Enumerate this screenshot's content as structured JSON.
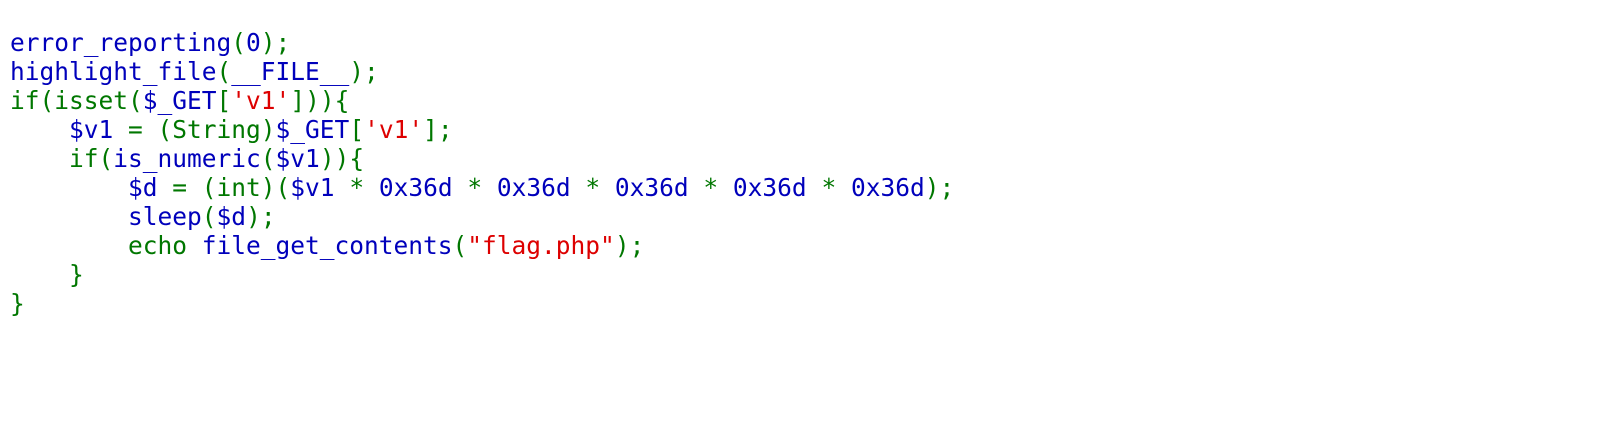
{
  "colors": {
    "default": "#0000BB",
    "keyword": "#007700",
    "string": "#DD0000",
    "background": "#FFFFFF"
  },
  "code": {
    "lines": [
      [
        {
          "t": "error_reporting",
          "c": "default"
        },
        {
          "t": "(",
          "c": "keyword"
        },
        {
          "t": "0",
          "c": "default"
        },
        {
          "t": ");",
          "c": "keyword"
        }
      ],
      [
        {
          "t": "highlight_file",
          "c": "default"
        },
        {
          "t": "(",
          "c": "keyword"
        },
        {
          "t": "__FILE__",
          "c": "default"
        },
        {
          "t": ");",
          "c": "keyword"
        }
      ],
      [
        {
          "t": "if(isset(",
          "c": "keyword"
        },
        {
          "t": "$_GET",
          "c": "default"
        },
        {
          "t": "[",
          "c": "keyword"
        },
        {
          "t": "'v1'",
          "c": "string"
        },
        {
          "t": "])){",
          "c": "keyword"
        }
      ],
      [
        {
          "t": "    ",
          "c": "keyword"
        },
        {
          "t": "$v1 ",
          "c": "default"
        },
        {
          "t": "= (String)",
          "c": "keyword"
        },
        {
          "t": "$_GET",
          "c": "default"
        },
        {
          "t": "[",
          "c": "keyword"
        },
        {
          "t": "'v1'",
          "c": "string"
        },
        {
          "t": "];",
          "c": "keyword"
        }
      ],
      [
        {
          "t": "    if(",
          "c": "keyword"
        },
        {
          "t": "is_numeric",
          "c": "default"
        },
        {
          "t": "(",
          "c": "keyword"
        },
        {
          "t": "$v1",
          "c": "default"
        },
        {
          "t": ")){",
          "c": "keyword"
        }
      ],
      [
        {
          "t": "        ",
          "c": "keyword"
        },
        {
          "t": "$d ",
          "c": "default"
        },
        {
          "t": "= (int)(",
          "c": "keyword"
        },
        {
          "t": "$v1 ",
          "c": "default"
        },
        {
          "t": "* ",
          "c": "keyword"
        },
        {
          "t": "0x36d ",
          "c": "default"
        },
        {
          "t": "* ",
          "c": "keyword"
        },
        {
          "t": "0x36d ",
          "c": "default"
        },
        {
          "t": "* ",
          "c": "keyword"
        },
        {
          "t": "0x36d ",
          "c": "default"
        },
        {
          "t": "* ",
          "c": "keyword"
        },
        {
          "t": "0x36d ",
          "c": "default"
        },
        {
          "t": "* ",
          "c": "keyword"
        },
        {
          "t": "0x36d",
          "c": "default"
        },
        {
          "t": ");",
          "c": "keyword"
        }
      ],
      [
        {
          "t": "        ",
          "c": "keyword"
        },
        {
          "t": "sleep",
          "c": "default"
        },
        {
          "t": "(",
          "c": "keyword"
        },
        {
          "t": "$d",
          "c": "default"
        },
        {
          "t": ");",
          "c": "keyword"
        }
      ],
      [
        {
          "t": "        echo ",
          "c": "keyword"
        },
        {
          "t": "file_get_contents",
          "c": "default"
        },
        {
          "t": "(",
          "c": "keyword"
        },
        {
          "t": "\"flag.php\"",
          "c": "string"
        },
        {
          "t": ");",
          "c": "keyword"
        }
      ],
      [
        {
          "t": "    }",
          "c": "keyword"
        }
      ],
      [
        {
          "t": "}",
          "c": "keyword"
        }
      ]
    ]
  }
}
